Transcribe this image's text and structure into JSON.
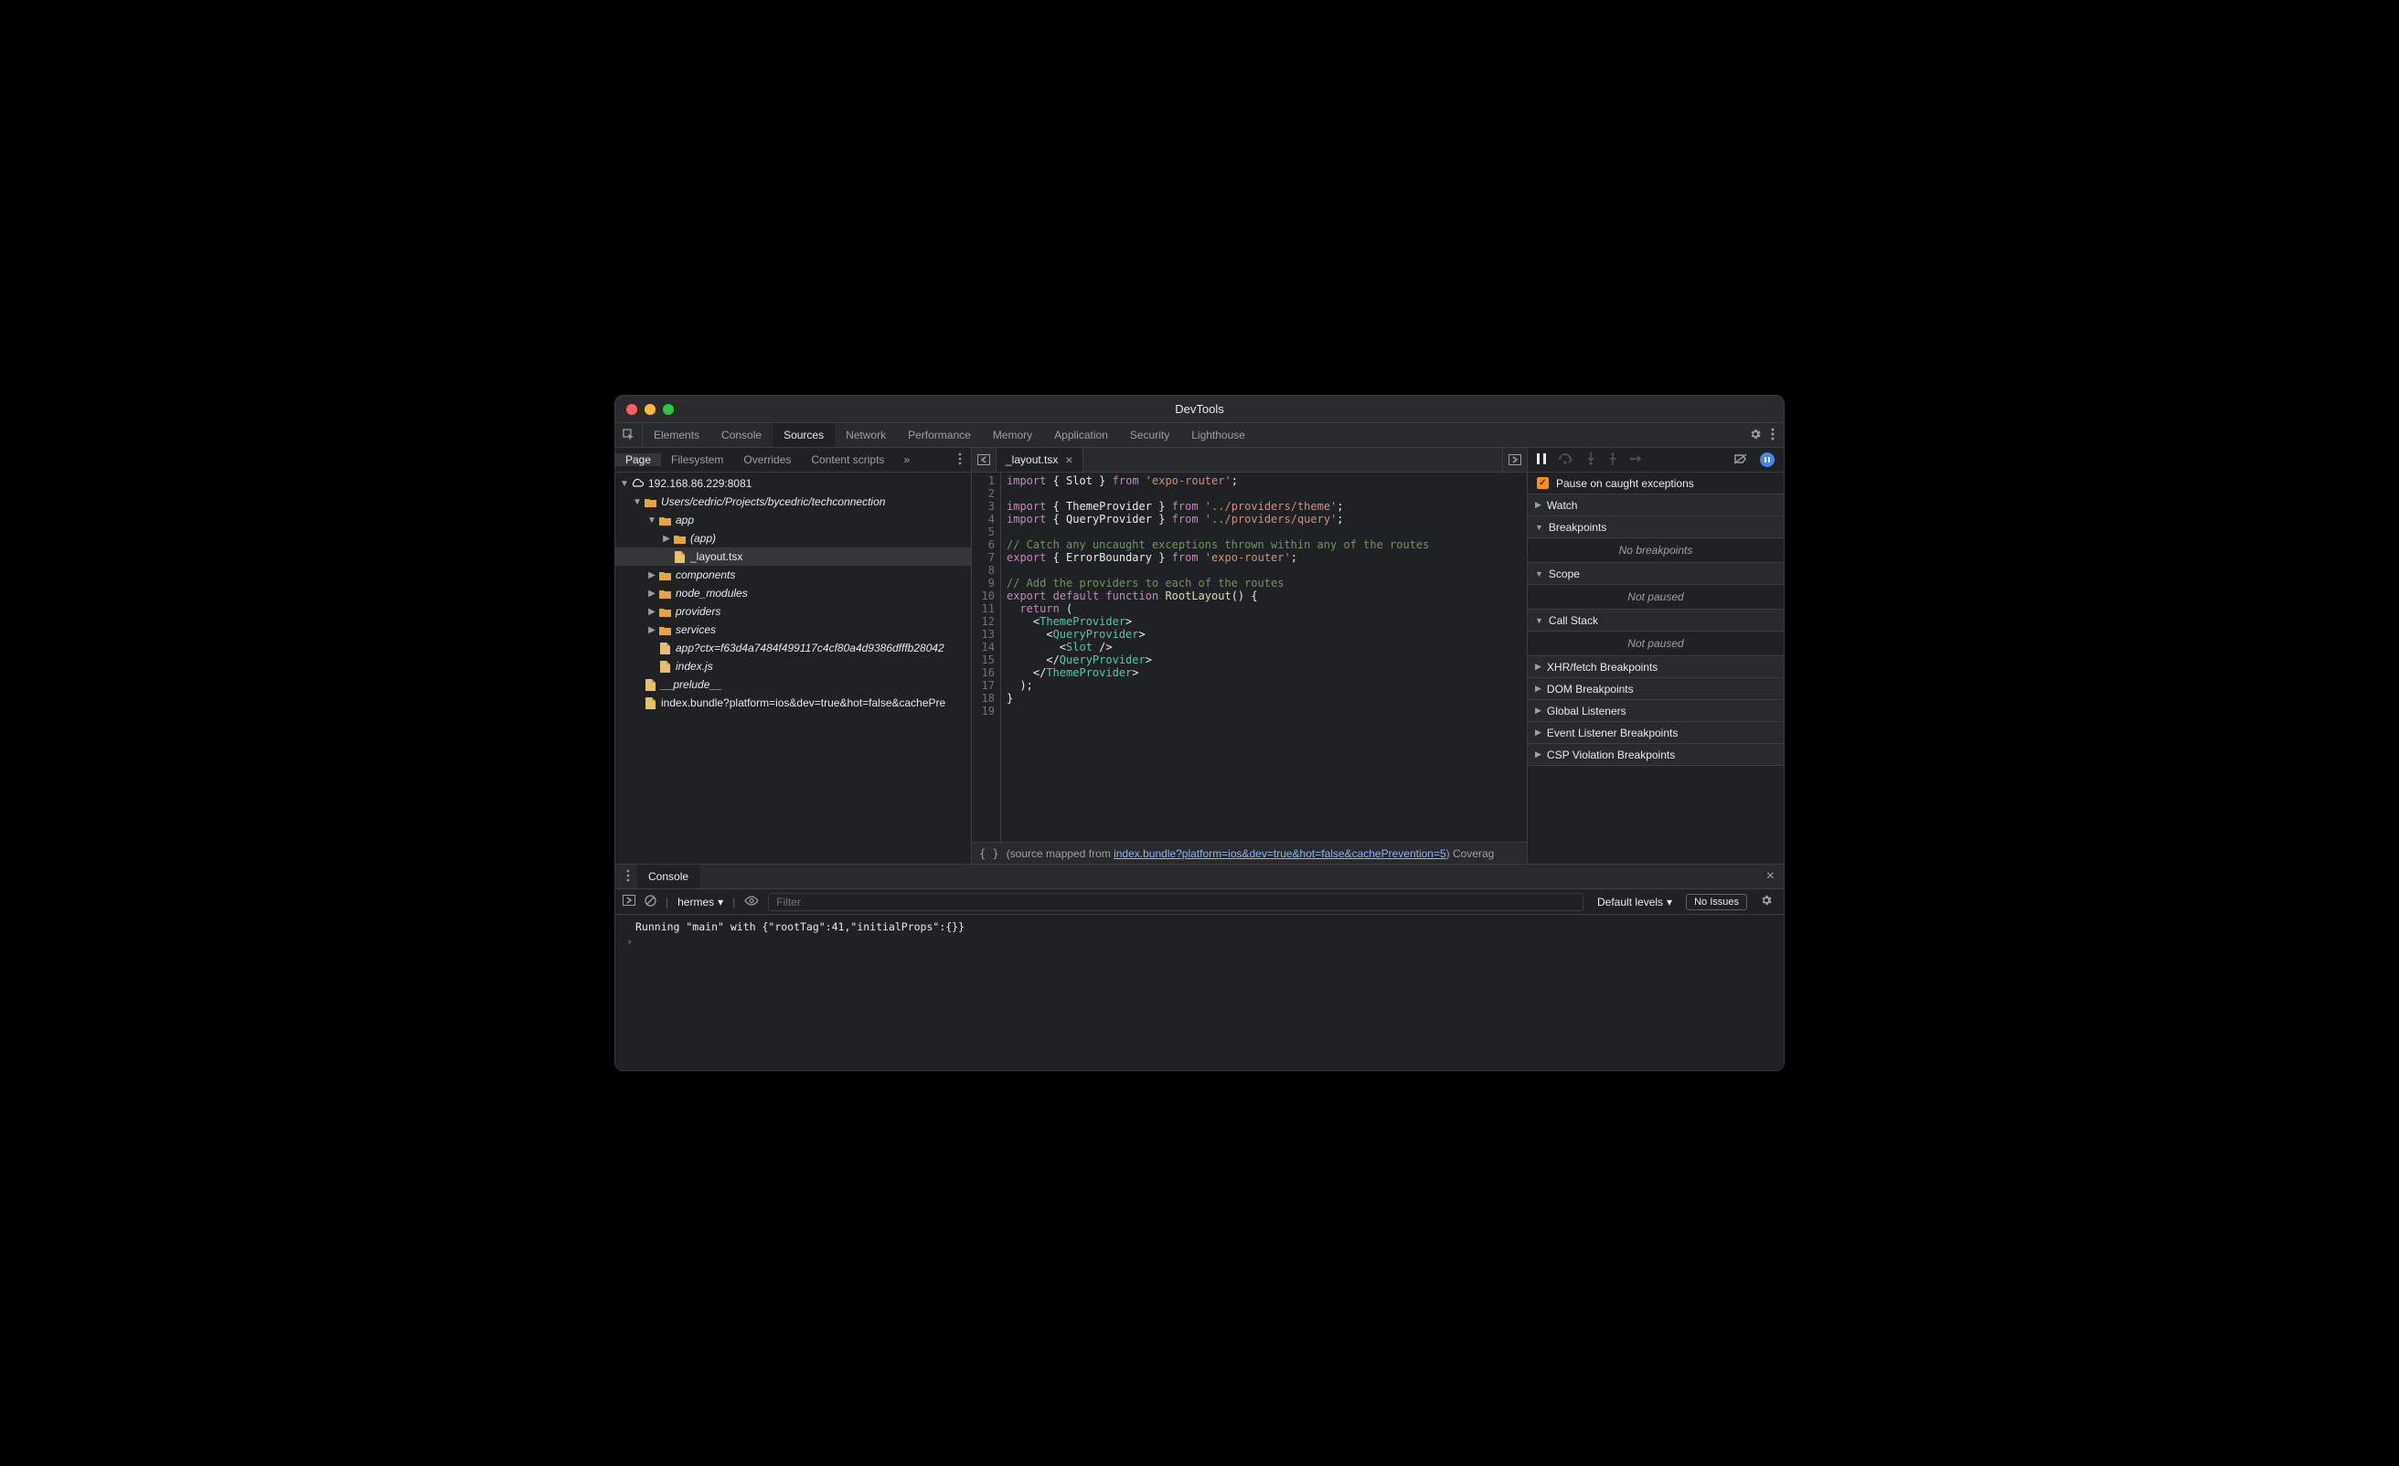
{
  "window_title": "DevTools",
  "main_tabs": [
    "Elements",
    "Console",
    "Sources",
    "Network",
    "Performance",
    "Memory",
    "Application",
    "Security",
    "Lighthouse"
  ],
  "main_tab_active": "Sources",
  "sources_subtabs": [
    "Page",
    "Filesystem",
    "Overrides",
    "Content scripts"
  ],
  "sources_subtab_active": "Page",
  "tree": {
    "origin": "192.168.86.229:8081",
    "root_folder": "Users/cedric/Projects/bycedric/techconnection",
    "app": "app",
    "app_nested": "(app)",
    "layout_file": "_layout.tsx",
    "components": "components",
    "node_modules": "node_modules",
    "providers": "providers",
    "services": "services",
    "app_ctx_file": "app?ctx=f63d4a7484f499117c4cf80a4d9386dfffb28042",
    "index_file": "index.js",
    "prelude": "__prelude__",
    "bundle": "index.bundle?platform=ios&dev=true&hot=false&cachePre"
  },
  "editor_tab": "_layout.tsx",
  "code_lines": [
    {
      "n": 1,
      "tokens": [
        [
          "kw",
          "import"
        ],
        [
          "id",
          " { "
        ],
        [
          "id",
          "Slot"
        ],
        [
          "id",
          " } "
        ],
        [
          "kw",
          "from"
        ],
        [
          "id",
          " "
        ],
        [
          "str",
          "'expo-router'"
        ],
        [
          "id",
          ";"
        ]
      ]
    },
    {
      "n": 2,
      "tokens": []
    },
    {
      "n": 3,
      "tokens": [
        [
          "kw",
          "import"
        ],
        [
          "id",
          " { "
        ],
        [
          "id",
          "ThemeProvider"
        ],
        [
          "id",
          " } "
        ],
        [
          "kw",
          "from"
        ],
        [
          "id",
          " "
        ],
        [
          "str",
          "'../providers/theme'"
        ],
        [
          "id",
          ";"
        ]
      ]
    },
    {
      "n": 4,
      "tokens": [
        [
          "kw",
          "import"
        ],
        [
          "id",
          " { "
        ],
        [
          "id",
          "QueryProvider"
        ],
        [
          "id",
          " } "
        ],
        [
          "kw",
          "from"
        ],
        [
          "id",
          " "
        ],
        [
          "str",
          "'../providers/query'"
        ],
        [
          "id",
          ";"
        ]
      ]
    },
    {
      "n": 5,
      "tokens": []
    },
    {
      "n": 6,
      "tokens": [
        [
          "comment",
          "// Catch any uncaught exceptions thrown within any of the routes"
        ]
      ]
    },
    {
      "n": 7,
      "tokens": [
        [
          "kw",
          "export"
        ],
        [
          "id",
          " { "
        ],
        [
          "id",
          "ErrorBoundary"
        ],
        [
          "id",
          " } "
        ],
        [
          "kw",
          "from"
        ],
        [
          "id",
          " "
        ],
        [
          "str",
          "'expo-router'"
        ],
        [
          "id",
          ";"
        ]
      ]
    },
    {
      "n": 8,
      "tokens": []
    },
    {
      "n": 9,
      "tokens": [
        [
          "comment",
          "// Add the providers to each of the routes"
        ]
      ]
    },
    {
      "n": 10,
      "tokens": [
        [
          "kw",
          "export"
        ],
        [
          "id",
          " "
        ],
        [
          "kw",
          "default"
        ],
        [
          "id",
          " "
        ],
        [
          "kw",
          "function"
        ],
        [
          "id",
          " "
        ],
        [
          "fn",
          "RootLayout"
        ],
        [
          "id",
          "() {"
        ]
      ]
    },
    {
      "n": 11,
      "tokens": [
        [
          "id",
          "  "
        ],
        [
          "kw",
          "return"
        ],
        [
          "id",
          " ("
        ]
      ]
    },
    {
      "n": 12,
      "tokens": [
        [
          "id",
          "    <"
        ],
        [
          "tag",
          "ThemeProvider"
        ],
        [
          "id",
          ">"
        ]
      ]
    },
    {
      "n": 13,
      "tokens": [
        [
          "id",
          "      <"
        ],
        [
          "tag",
          "QueryProvider"
        ],
        [
          "id",
          ">"
        ]
      ]
    },
    {
      "n": 14,
      "tokens": [
        [
          "id",
          "        <"
        ],
        [
          "tag",
          "Slot"
        ],
        [
          "id",
          " />"
        ]
      ]
    },
    {
      "n": 15,
      "tokens": [
        [
          "id",
          "      </"
        ],
        [
          "tag",
          "QueryProvider"
        ],
        [
          "id",
          ">"
        ]
      ]
    },
    {
      "n": 16,
      "tokens": [
        [
          "id",
          "    </"
        ],
        [
          "tag",
          "ThemeProvider"
        ],
        [
          "id",
          ">"
        ]
      ]
    },
    {
      "n": 17,
      "tokens": [
        [
          "id",
          "  );"
        ]
      ]
    },
    {
      "n": 18,
      "tokens": [
        [
          "id",
          "}"
        ]
      ]
    },
    {
      "n": 19,
      "tokens": []
    }
  ],
  "editor_footer": {
    "prefix": "(source mapped from ",
    "link": "index.bundle?platform=ios&dev=true&hot=false&cachePrevention=5",
    "suffix": ")  Coverag"
  },
  "debugger": {
    "pause_checkbox_label": "Pause on caught exceptions",
    "sections": [
      {
        "title": "Watch",
        "open": false
      },
      {
        "title": "Breakpoints",
        "open": true,
        "body": "No breakpoints"
      },
      {
        "title": "Scope",
        "open": true,
        "body": "Not paused"
      },
      {
        "title": "Call Stack",
        "open": true,
        "body": "Not paused"
      },
      {
        "title": "XHR/fetch Breakpoints",
        "open": false
      },
      {
        "title": "DOM Breakpoints",
        "open": false
      },
      {
        "title": "Global Listeners",
        "open": false
      },
      {
        "title": "Event Listener Breakpoints",
        "open": false
      },
      {
        "title": "CSP Violation Breakpoints",
        "open": false
      }
    ]
  },
  "drawer_tab": "Console",
  "console": {
    "context": "hermes",
    "filter_placeholder": "Filter",
    "levels": "Default levels",
    "issues": "No Issues",
    "log": "Running \"main\" with {\"rootTag\":41,\"initialProps\":{}}"
  }
}
